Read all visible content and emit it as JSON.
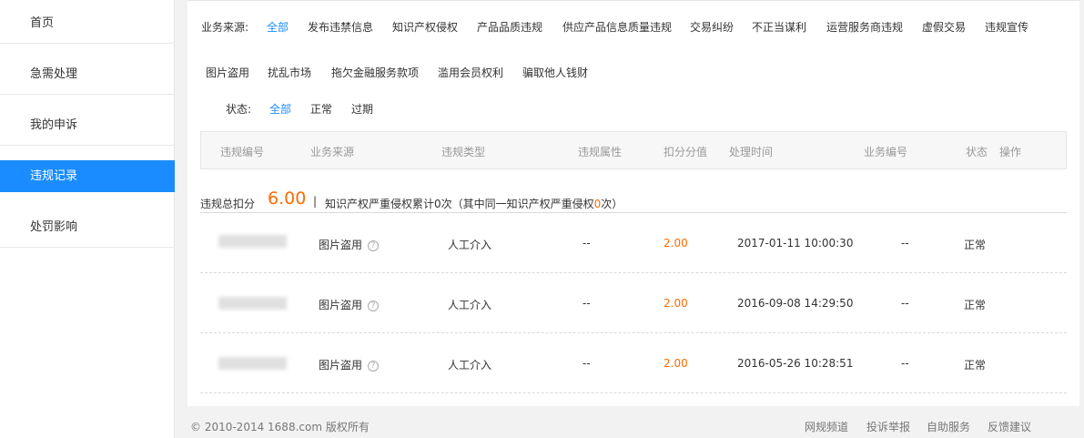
{
  "sidebar": {
    "items": [
      {
        "label": "首页"
      },
      {
        "label": "急需处理"
      },
      {
        "label": "我的申诉"
      },
      {
        "label": "违规记录"
      },
      {
        "label": "处罚影响"
      }
    ]
  },
  "filters": {
    "source_label": "业务来源:",
    "source_options": [
      "全部",
      "发布违禁信息",
      "知识产权侵权",
      "产品品质违规",
      "供应产品信息质量违规",
      "交易纠纷",
      "不正当谋利",
      "运营服务商违规",
      "虚假交易",
      "违规宣传",
      "图片盗用",
      "扰乱市场",
      "拖欠金融服务款项",
      "滥用会员权利",
      "骗取他人钱财"
    ],
    "status_label": "状态:",
    "status_options": [
      "全部",
      "正常",
      "过期"
    ]
  },
  "table": {
    "headers": [
      "违规编号",
      "业务来源",
      "违规类型",
      "违规属性",
      "扣分分值",
      "处理时间",
      "业务编号",
      "状态",
      "操作"
    ],
    "summary": {
      "label": "违规总扣分",
      "score": "6.00",
      "separator": "|",
      "text_before": "知识产权严重侵权累计0次（其中同一知识产权严重侵权",
      "text_num": "0",
      "text_after": "次）"
    },
    "rows": [
      {
        "source": "图片盗用",
        "type": "人工介入",
        "attr": "--",
        "score": "2.00",
        "time": "2017-01-11 10:00:30",
        "biz_no": "--",
        "status": "正常"
      },
      {
        "source": "图片盗用",
        "type": "人工介入",
        "attr": "--",
        "score": "2.00",
        "time": "2016-09-08 14:29:50",
        "biz_no": "--",
        "status": "正常"
      },
      {
        "source": "图片盗用",
        "type": "人工介入",
        "attr": "--",
        "score": "2.00",
        "time": "2016-05-26 10:28:51",
        "biz_no": "--",
        "status": "正常"
      }
    ],
    "help_glyph": "?"
  },
  "footer": {
    "copyright": "© 2010-2014 1688.com 版权所有",
    "links": [
      "网规频道",
      "投诉举报",
      "自助服务",
      "反馈建议"
    ]
  },
  "colors": {
    "accent": "#1a8cff",
    "score": "#ff6a00"
  }
}
